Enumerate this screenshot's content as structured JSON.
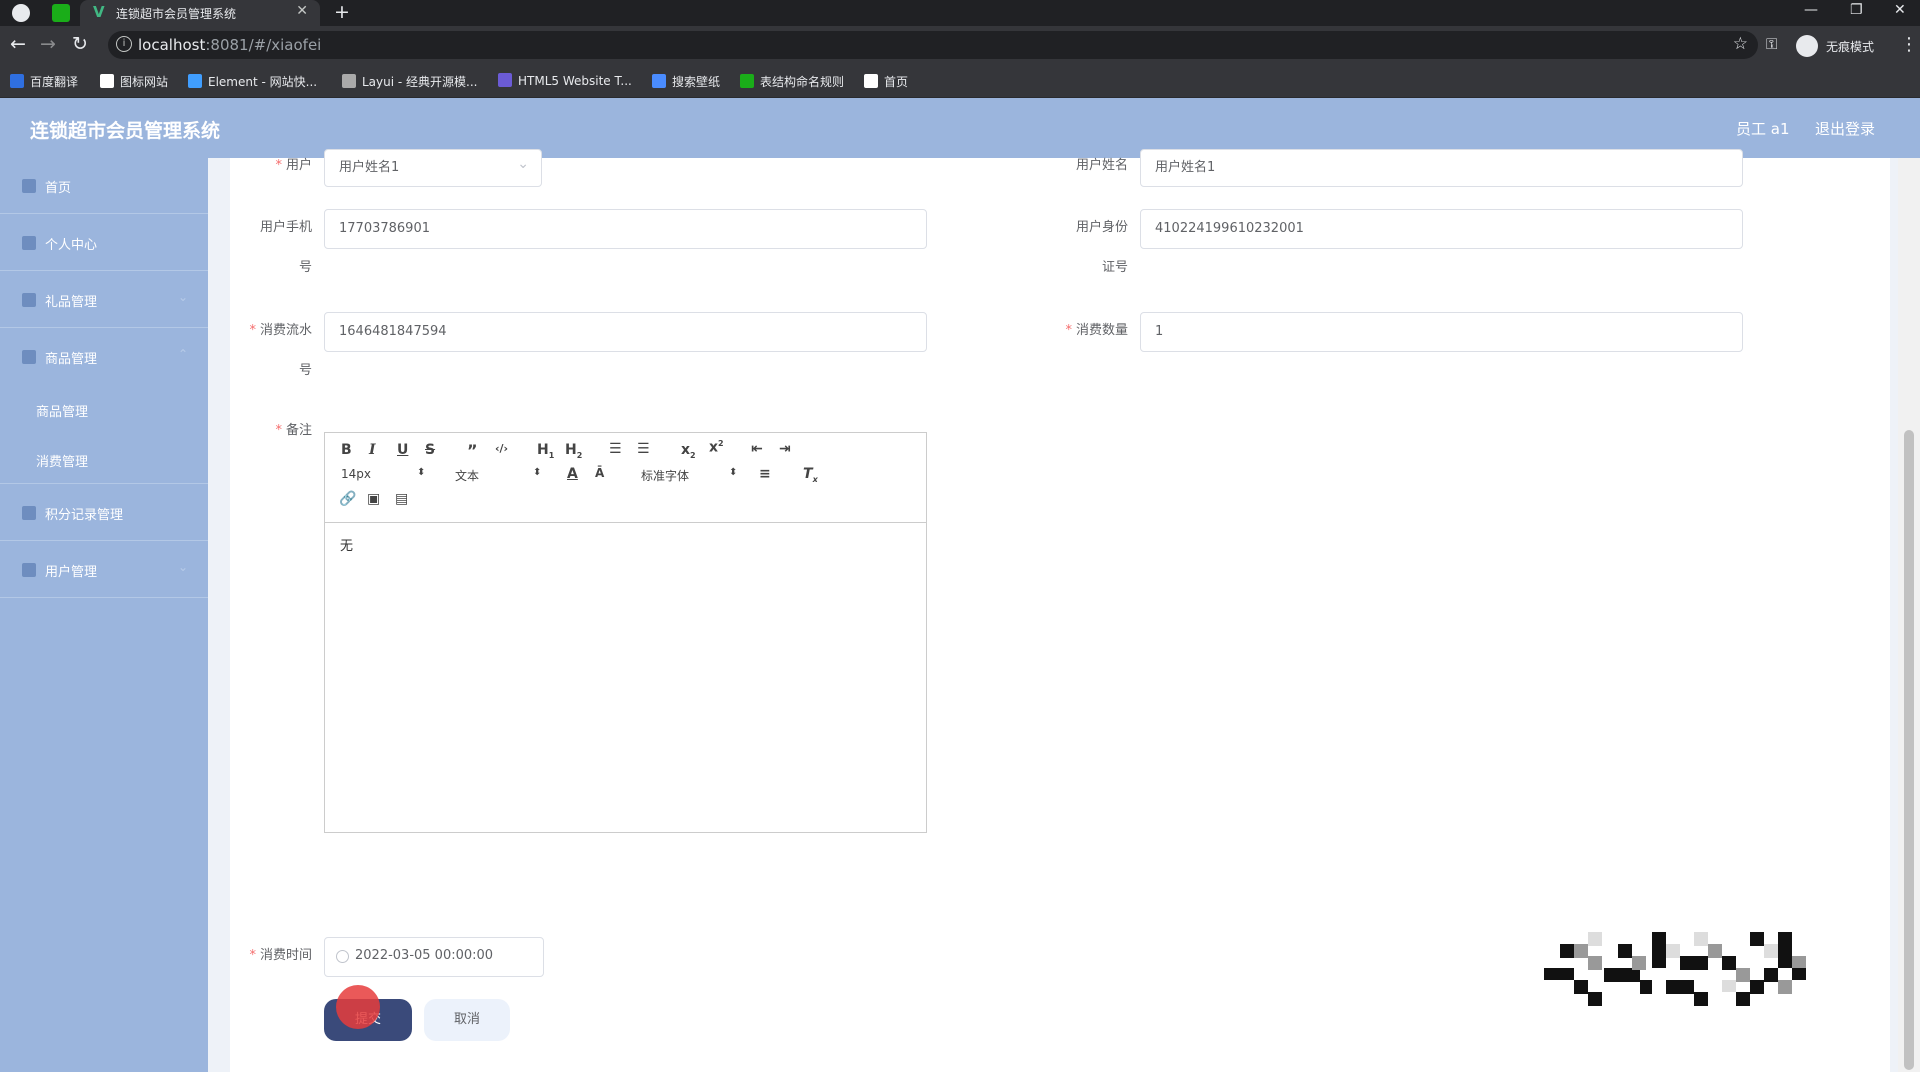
{
  "browser": {
    "tab_title": "连锁超市会员管理系统",
    "url_host": "localhost",
    "url_path": ":8081/#/xiaofei",
    "incognito_label": "无痕模式",
    "bookmarks": [
      {
        "label": "百度翻译",
        "icon": "baidu-translate-icon",
        "color": "#2f6fe0"
      },
      {
        "label": "图标网站",
        "icon": "flag-icon",
        "color": "#ffffff"
      },
      {
        "label": "Element - 网站快...",
        "icon": "element-icon",
        "color": "#409eff"
      },
      {
        "label": "Layui - 经典开源模...",
        "icon": "layui-icon",
        "color": "#aaaaaa"
      },
      {
        "label": "HTML5 Website T...",
        "icon": "html5-icon",
        "color": "#6b5bd6"
      },
      {
        "label": "搜索壁纸",
        "icon": "wallpaper-icon",
        "color": "#4a8cff"
      },
      {
        "label": "表结构命名规则",
        "icon": "table-icon",
        "color": "#1aad19"
      },
      {
        "label": "首页",
        "icon": "globe-icon",
        "color": "#ffffff"
      }
    ]
  },
  "app": {
    "title": "连锁超市会员管理系统",
    "user": "员工 a1",
    "logout": "退出登录"
  },
  "sidebar": {
    "items": [
      {
        "label": "首页",
        "icon": "home-icon"
      },
      {
        "label": "个人中心",
        "icon": "user-icon"
      },
      {
        "label": "礼品管理",
        "icon": "gift-icon"
      },
      {
        "label": "商品管理",
        "icon": "goods-icon"
      },
      {
        "label": "积分记录管理",
        "icon": "points-icon"
      },
      {
        "label": "用户管理",
        "icon": "users-icon"
      }
    ],
    "sub_items": [
      "商品管理",
      "消费管理"
    ]
  },
  "form": {
    "user_label": "用户",
    "user_value": "用户姓名1",
    "username_label": "用户姓名",
    "username_value": "用户姓名1",
    "phone_label_1": "用户手机",
    "phone_label_2": "号",
    "phone_value": "17703786901",
    "idcard_label_1": "用户身份",
    "idcard_label_2": "证号",
    "idcard_value": "410224199610232001",
    "serial_label_1": "消费流水",
    "serial_label_2": "号",
    "serial_value": "1646481847594",
    "quantity_label": "消费数量",
    "quantity_value": "1",
    "remark_label": "备注",
    "remark_value": "无",
    "editor": {
      "font_size": "14px",
      "block_type": "文本",
      "font_family": "标准字体"
    },
    "time_label": "消费时间",
    "time_value": "2022-03-05 00:00:00",
    "submit": "提交",
    "cancel": "取消"
  }
}
